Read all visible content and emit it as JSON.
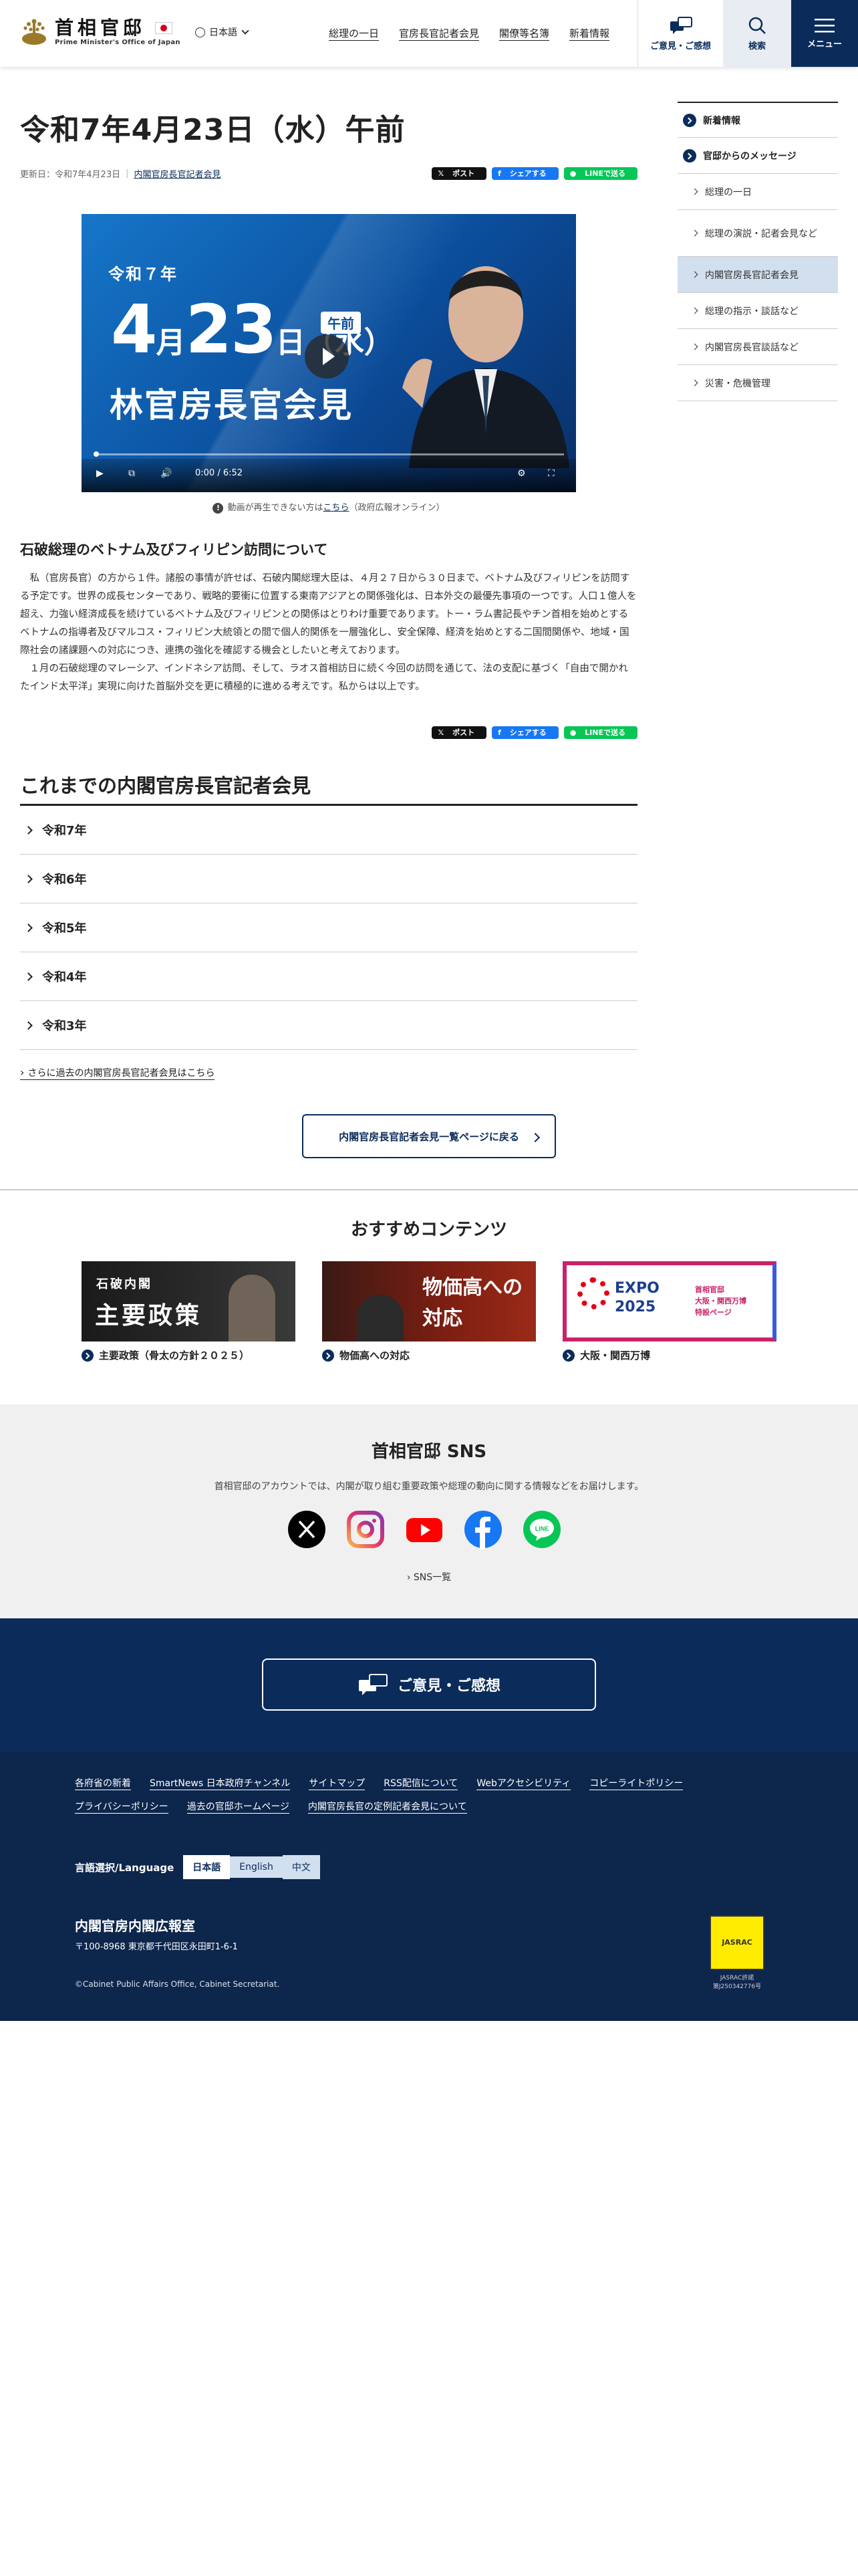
{
  "header": {
    "logo_ja": "首相官邸",
    "logo_en": "Prime Minister's Office of Japan",
    "language": "日本語",
    "nav": [
      "総理の一日",
      "官房長官記者会見",
      "閣僚等名簿",
      "新着情報"
    ],
    "opinion_label": "ご意見・ご感想",
    "search_label": "検索",
    "menu_label": "メニュー"
  },
  "main": {
    "title": "令和7年4月23日（水）午前",
    "updated": "更新日：令和7年4月23日",
    "category_link": "内閣官房長官記者会見",
    "share": {
      "x": "ポスト",
      "facebook": "シェアする",
      "line": "LINEで送る"
    },
    "video": {
      "era": "令和７年",
      "month": "4",
      "month_unit": "月",
      "day": "23",
      "day_unit": "日（水）",
      "ampm": "午前",
      "title": "林官房長官会見",
      "time": "0:00 / 6:52",
      "played_fraction": 0.0
    },
    "video_note_prefix": "動画が再生できない方は",
    "video_note_link": "こちら",
    "video_note_suffix": "（政府広報オンライン）",
    "section_title": "石破総理のベトナム及びフィリピン訪問について",
    "paragraphs": [
      "私（官房長官）の方から１件。諸般の事情が許せば、石破内閣総理大臣は、４月２７日から３０日まで、ベトナム及びフィリピンを訪問する予定です。世界の成長センターであり、戦略的要衝に位置する東南アジアとの関係強化は、日本外交の最優先事項の一つです。人口１億人を超え、力強い経済成長を続けているベトナム及びフィリピンとの関係はとりわけ重要であります。トー・ラム書記長やチン首相を始めとするベトナムの指導者及びマルコス・フィリピン大統領との間で個人的関係を一層強化し、安全保障、経済を始めとする二国間関係や、地域・国際社会の諸課題への対応につき、連携の強化を確認する機会としたいと考えております。",
      "１月の石破総理のマレーシア、インドネシア訪問、そして、ラオス首相訪日に続く今回の訪問を通じて、法の支配に基づく「自由で開かれたインド太平洋」実現に向けた首脳外交を更に積極的に進める考えです。私からは以上です。"
    ],
    "archive_title": "これまでの内閣官房長官記者会見",
    "archive_years": [
      "令和7年",
      "令和6年",
      "令和5年",
      "令和4年",
      "令和3年"
    ],
    "more_link": "さらに過去の内閣官房長官記者会見はこちら",
    "back_button": "内閣官房長官記者会見一覧ページに戻る"
  },
  "sidebar": {
    "items": [
      {
        "label": "新着情報",
        "level": "top"
      },
      {
        "label": "官邸からのメッセージ",
        "level": "top"
      },
      {
        "label": "総理の一日",
        "level": "sub"
      },
      {
        "label": "総理の演説・記者会見など",
        "level": "sub"
      },
      {
        "label": "内閣官房長官記者会見",
        "level": "sub",
        "active": true
      },
      {
        "label": "総理の指示・談話など",
        "level": "sub"
      },
      {
        "label": "内閣官房長官談話など",
        "level": "sub"
      },
      {
        "label": "災害・危機管理",
        "level": "sub"
      }
    ]
  },
  "recommend": {
    "title": "おすすめコンテンツ",
    "cards": [
      {
        "label": "主要政策（骨太の方針２０２５）",
        "img_line1": "石破内閣",
        "img_line2": "主要政策"
      },
      {
        "label": "物価高への対応",
        "img_line1": "物価高への",
        "img_line2": "対応"
      },
      {
        "label": "大阪・関西万博",
        "img_line1": "首相官邸",
        "img_line2": "大阪・関西万博",
        "img_line3": "特設ページ",
        "expo": "EXPO",
        "expo_year": "2025"
      }
    ]
  },
  "sns": {
    "title": "首相官邸 SNS",
    "desc": "首相官邸のアカウントでは、内閣が取り組む重要政策や総理の動向に関する情報などをお届けします。",
    "icons": [
      "x-icon",
      "instagram-icon",
      "youtube-icon",
      "facebook-icon",
      "line-icon"
    ],
    "list_link": "SNS一覧"
  },
  "footer": {
    "opinion_button": "ご意見・ご感想",
    "links": [
      "各府省の新着",
      "SmartNews 日本政府チャンネル",
      "サイトマップ",
      "RSS配信について",
      "Webアクセシビリティ",
      "コピーライトポリシー",
      "プライバシーポリシー",
      "過去の官邸ホームページ",
      "内閣官房長官の定例記者会見について"
    ],
    "lang_label": "言語選択/Language",
    "langs": [
      "日本語",
      "English",
      "中文"
    ],
    "org": "内閣官房内閣広報室",
    "address": "〒100-8968 東京都千代田区永田町1-6-1",
    "copyright": "©Cabinet Public Affairs Office, Cabinet Secretariat.",
    "jasrac_logo_text": "JASRAC",
    "jasrac_line1": "JASRAC許諾",
    "jasrac_line2": "第J250342776号"
  },
  "colors": {
    "navy": "#0b2c5a",
    "active_bg": "#d1dfee",
    "accent_blue": "#0b4d9b"
  }
}
